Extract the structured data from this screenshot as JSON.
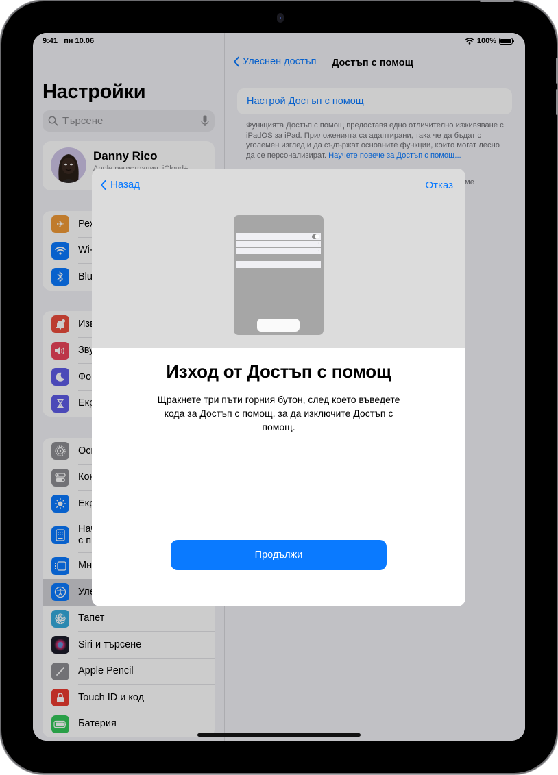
{
  "status_bar": {
    "time": "9:41",
    "date": "пн 10.06",
    "battery": "100%"
  },
  "sidebar": {
    "title": "Настройки",
    "search_placeholder": "Търсене",
    "profile": {
      "name": "Danny Rico",
      "subtitle": "Apple регистрация, iCloud+..."
    },
    "groups": [
      [
        {
          "label": "Режим Самолет",
          "icon": "airplane-icon",
          "color": "#f09a37"
        },
        {
          "label": "Wi-Fi",
          "icon": "wifi-icon",
          "color": "#0a7aff"
        },
        {
          "label": "Bluetooth",
          "icon": "bluetooth-icon",
          "color": "#0a7aff"
        }
      ],
      [
        {
          "label": "Известия",
          "icon": "bell-icon",
          "color": "#eb4d3d"
        },
        {
          "label": "Звуци",
          "icon": "speaker-icon",
          "color": "#eb445a"
        },
        {
          "label": "Фокус",
          "icon": "moon-icon",
          "color": "#5e5ce6"
        },
        {
          "label": "Екранно време",
          "icon": "hourglass-icon",
          "color": "#5e5ce6"
        }
      ],
      [
        {
          "label": "Основни",
          "icon": "gear-icon",
          "color": "#8e8e93"
        },
        {
          "label": "Контролен център",
          "icon": "switches-icon",
          "color": "#8e8e93"
        },
        {
          "label": "Екран и яркост",
          "icon": "sun-icon",
          "color": "#0a7aff"
        },
        {
          "label": "Начален екран и библиотека с приложения",
          "label_line2": "с п",
          "icon": "home-screen-icon",
          "color": "#0a7aff"
        },
        {
          "label": "Многозадачност",
          "icon": "multitasking-icon",
          "color": "#0a7aff"
        },
        {
          "label": "Улеснен достъп",
          "icon": "accessibility-icon",
          "color": "#0a7aff",
          "selected": true
        },
        {
          "label": "Тапет",
          "icon": "wallpaper-icon",
          "color": "#35aadc"
        },
        {
          "label": "Siri и търсене",
          "icon": "siri-icon",
          "color": "#222"
        },
        {
          "label": "Apple Pencil",
          "icon": "pencil-icon",
          "color": "#8e8e93"
        },
        {
          "label": "Touch ID и код",
          "icon": "lock-icon",
          "color": "#eb3b30"
        },
        {
          "label": "Батерия",
          "icon": "battery-icon",
          "color": "#34c759"
        }
      ]
    ]
  },
  "detail": {
    "back_label": "Улеснен достъп",
    "title": "Достъп с помощ",
    "setup_link": "Настрой Достъп с помощ",
    "description": "Функцията Достъп с помощ предоставя едно отличително изживяване с iPadOS за iPad. Приложенията са адаптирани, така че да бъдат с уголемен изглед и да съдържат основните функции, които могат лесно да се персонализират. ",
    "learn_more": "Научете повече за Достъп с помощ...",
    "partial_text": "ме"
  },
  "modal": {
    "back_label": "Назад",
    "cancel_label": "Отказ",
    "title": "Изход от Достъп с помощ",
    "body": "Щракнете три пъти горния бутон, след което въведете кода за Достъп с помощ, за да изключите Достъп с помощ.",
    "continue_label": "Продължи"
  }
}
